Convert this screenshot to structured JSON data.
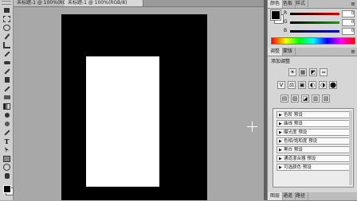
{
  "tabs": {
    "doc1": "未标题-1 @ 100%(RGB/8)",
    "doc2": "未标题-1 @ 100%(RGB/8)"
  },
  "panel_tabs": [
    "颜色",
    "色板",
    "样式"
  ],
  "adjust_tabs": [
    "调整",
    "蒙版"
  ],
  "color": {
    "r_label": "R",
    "g_label": "G",
    "b_label": "B",
    "r_value": "0",
    "g_value": "0",
    "b_value": "0"
  },
  "adjustments": {
    "title": "添加调整",
    "icons_row1": [
      "☀",
      "▦",
      "◩",
      "≈"
    ],
    "icons_row2": [
      "V",
      "⚖",
      "▣",
      "◐",
      "◑",
      "⬤"
    ],
    "icons_row3": [
      "▤",
      "▨",
      "◪",
      "▥",
      "▧"
    ]
  },
  "presets": [
    "色阶 预设",
    "曲线 预设",
    "曝光度 预设",
    "色相/饱和度 预设",
    "黑白 预设",
    "通道混合器 预设",
    "可选颜色 预设"
  ],
  "bottom_tabs": [
    "图层",
    "通道",
    "路径"
  ]
}
